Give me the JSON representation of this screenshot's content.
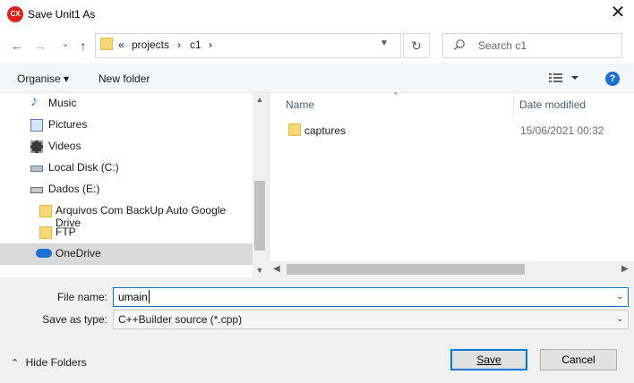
{
  "window": {
    "title": "Save Unit1 As",
    "app_icon_text": "CX",
    "close_glyph": "✕"
  },
  "navigation": {
    "back_glyph": "←",
    "forward_glyph": "→",
    "recent_glyph": "⌄",
    "up_glyph": "↑",
    "address": {
      "overflow": "«",
      "segments": [
        "projects",
        "c1"
      ],
      "separator": "›"
    },
    "refresh_glyph": "↻",
    "search_placeholder": "Search c1",
    "search_icon": "search-icon"
  },
  "toolbar": {
    "organise": "Organise",
    "organise_chevron": "▾",
    "new_folder": "New folder",
    "view_icon": "view-options-icon",
    "help_glyph": "?"
  },
  "nav_pane": {
    "items": [
      {
        "label": "Music",
        "icon": "music-icon"
      },
      {
        "label": "Pictures",
        "icon": "pictures-icon"
      },
      {
        "label": "Videos",
        "icon": "videos-icon"
      },
      {
        "label": "Local Disk (C:)",
        "icon": "local-disk-icon"
      },
      {
        "label": "Dados (E:)",
        "icon": "drive-icon"
      },
      {
        "label": "Arquivos Com BackUp Auto Google Drive",
        "icon": "folder-icon"
      },
      {
        "label": "FTP",
        "icon": "folder-icon"
      },
      {
        "label": "OneDrive",
        "icon": "onedrive-icon",
        "selected": true
      }
    ]
  },
  "file_list": {
    "columns": [
      "Name",
      "Date modified"
    ],
    "rows": [
      {
        "name": "captures",
        "date": "15/06/2021 00:32",
        "icon": "folder-icon"
      }
    ]
  },
  "form": {
    "file_name_label": "File name:",
    "file_name_value": "umain",
    "save_type_label": "Save as type:",
    "save_type_value": "C++Builder source (*.cpp)"
  },
  "footer": {
    "hide_folders": "Hide Folders",
    "hide_chevron": "⌃",
    "save": "Save",
    "cancel": "Cancel"
  },
  "colors": {
    "accent": "#0078d7",
    "folder": "#f8d775",
    "app_icon": "#e0201c",
    "help": "#1e6fce"
  }
}
